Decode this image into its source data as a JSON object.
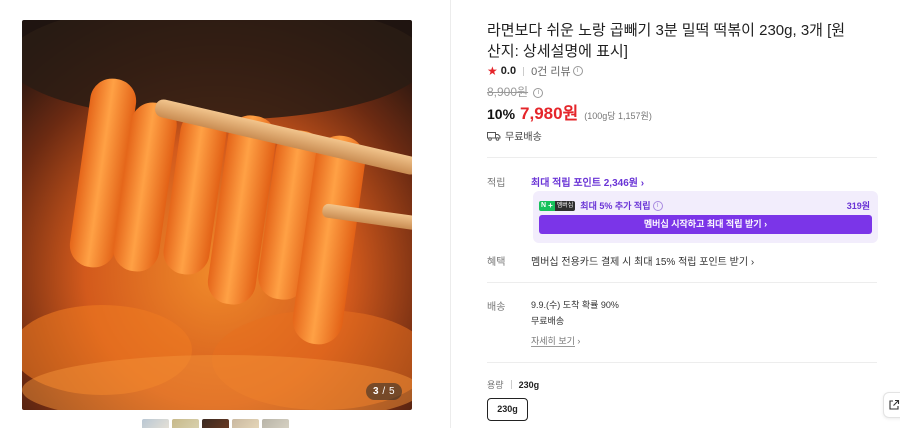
{
  "gallery": {
    "counter_current": "3",
    "counter_sep": " / ",
    "counter_total": "5",
    "thumbnails": 5
  },
  "product": {
    "title": "라면보다 쉬운 노랑 곱빼기 3분 밀떡 떡볶이 230g, 3개 [원산지: 상세설명에 표시]",
    "rating": "0.0",
    "reviews": "0건 리뷰",
    "original_price": "8,900원",
    "discount": "10%",
    "price": "7,980원",
    "unit_price": "(100g당 1,157원)",
    "shipping_tag": "무료배송"
  },
  "points": {
    "label": "적립",
    "max_link": "최대 적립 포인트 2,346원",
    "badge_n": "N",
    "badge_plus": "+",
    "badge_membership": "멤버십",
    "promo_text": "최대 5% 추가 적립",
    "promo_points": "319원",
    "promo_button": "멤버십 시작하고 최대 적립 받기"
  },
  "benefit": {
    "label": "혜택",
    "text": "멤버십 전용카드 결제 시 최대 15% 적립 포인트 받기"
  },
  "delivery": {
    "label": "배송",
    "line1": "9.9.(수) 도착 확률 90%",
    "line2": "무료배송",
    "more": "자세히 보기"
  },
  "option": {
    "label": "용량",
    "selected": "230g",
    "chip": "230g"
  },
  "colors": {
    "accent_red": "#e5252a",
    "accent_purple": "#7b35e8",
    "promo_bg": "#f2edfc",
    "naver_green": "#17c15b"
  },
  "icons": [
    "star-icon",
    "info-icon",
    "truck-icon",
    "chevron-right-icon",
    "share-icon"
  ]
}
